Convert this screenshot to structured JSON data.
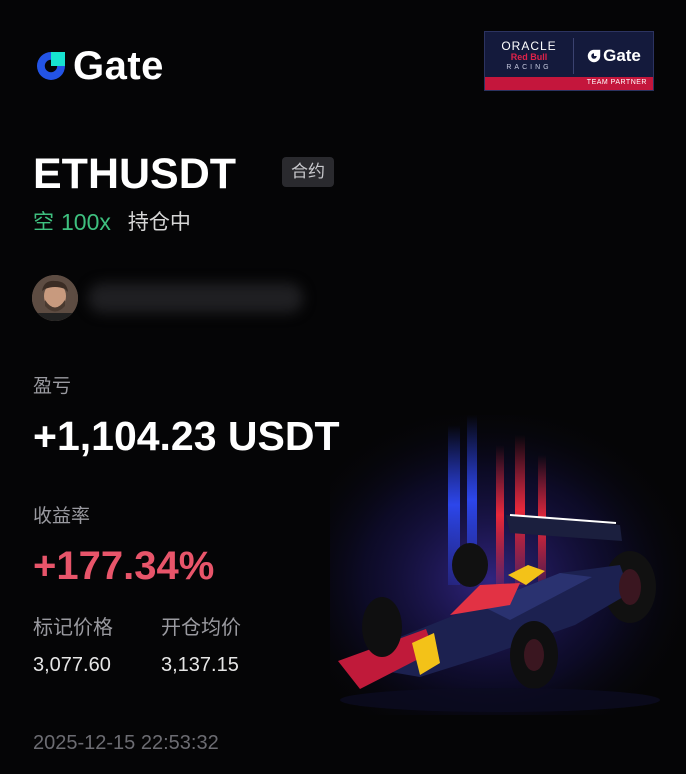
{
  "brand": {
    "name": "Gate"
  },
  "partner_badge": {
    "line1": "ORACLE",
    "line2": "Red Bull",
    "line3": "RACING",
    "brand": "Gate",
    "footer": "TEAM PARTNER"
  },
  "position": {
    "symbol": "ETHUSDT",
    "contract_tag": "合约",
    "direction": "空",
    "leverage": "100x",
    "status": "持仓中"
  },
  "pnl": {
    "label": "盈亏",
    "value": "+1,104.23 USDT"
  },
  "roi": {
    "label": "收益率",
    "value": "+177.34%"
  },
  "mark_price": {
    "label": "标记价格",
    "value": "3,077.60"
  },
  "entry_price": {
    "label": "开仓均价",
    "value": "3,137.15"
  },
  "timestamp": "2025-12-15 22:53:32",
  "colors": {
    "short": "#3ec07f",
    "profit": "#e8556a",
    "brand_blue": "#2354e6",
    "brand_cyan": "#17e3d0"
  }
}
